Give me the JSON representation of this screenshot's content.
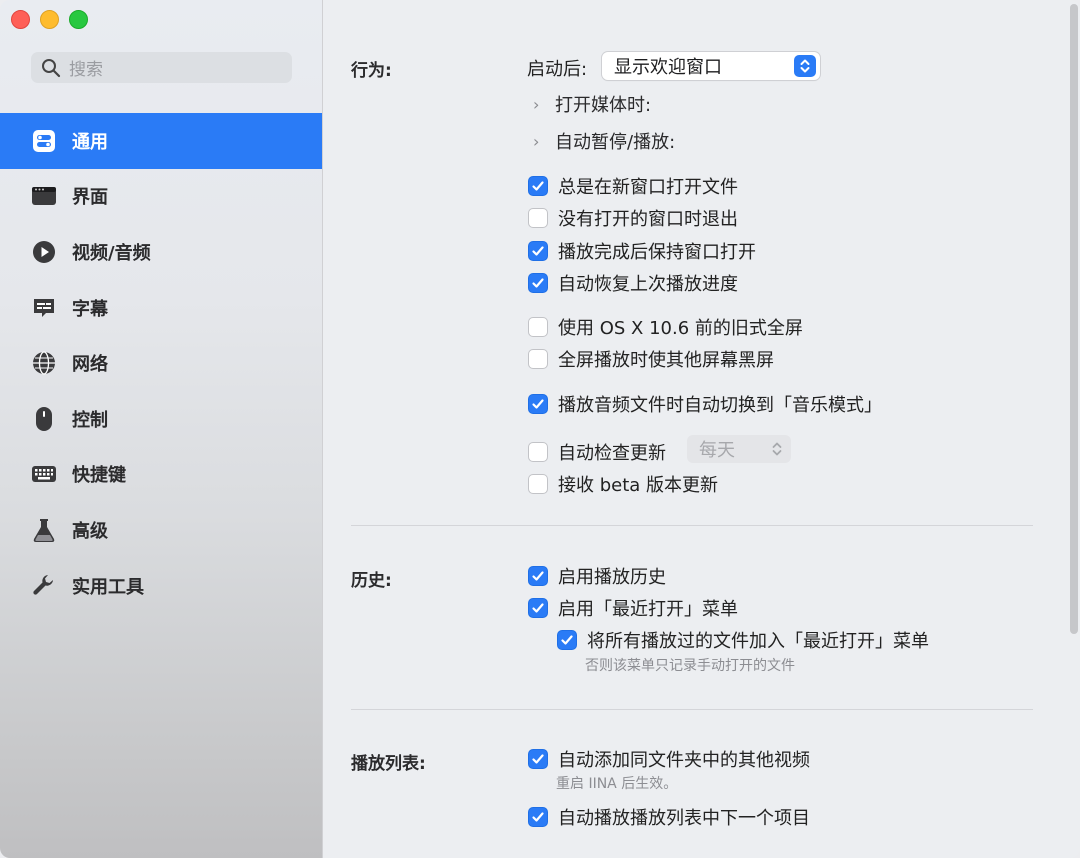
{
  "sidebar": {
    "search_placeholder": "搜索",
    "items": [
      {
        "label": "通用",
        "icon": "general-toggle-icon",
        "active": true
      },
      {
        "label": "界面",
        "icon": "window-icon",
        "active": false
      },
      {
        "label": "视频/音频",
        "icon": "play-circle-icon",
        "active": false
      },
      {
        "label": "字幕",
        "icon": "subtitle-bubble-icon",
        "active": false
      },
      {
        "label": "网络",
        "icon": "globe-icon",
        "active": false
      },
      {
        "label": "控制",
        "icon": "mouse-icon",
        "active": false
      },
      {
        "label": "快捷键",
        "icon": "keyboard-icon",
        "active": false
      },
      {
        "label": "高级",
        "icon": "flask-icon",
        "active": false
      },
      {
        "label": "实用工具",
        "icon": "wrench-icon",
        "active": false
      }
    ]
  },
  "behavior": {
    "label": "行为:",
    "after_launch_label": "启动后:",
    "after_launch_value": "显示欢迎窗口",
    "open_media_label": "打开媒体时:",
    "auto_pause_label": "自动暂停/播放:",
    "options": [
      {
        "label": "总是在新窗口打开文件",
        "checked": true
      },
      {
        "label": "没有打开的窗口时退出",
        "checked": false
      },
      {
        "label": "播放完成后保持窗口打开",
        "checked": true
      },
      {
        "label": "自动恢复上次播放进度",
        "checked": true
      },
      {
        "label": "使用 OS X 10.6 前的旧式全屏",
        "checked": false
      },
      {
        "label": "全屏播放时使其他屏幕黑屏",
        "checked": false
      },
      {
        "label": "播放音频文件时自动切换到「音乐模式」",
        "checked": true
      },
      {
        "label": "自动检查更新",
        "checked": false
      },
      {
        "label": "接收 beta 版本更新",
        "checked": false
      }
    ],
    "update_frequency": "每天"
  },
  "history": {
    "label": "历史:",
    "options": [
      {
        "label": "启用播放历史",
        "checked": true
      },
      {
        "label": "启用「最近打开」菜单",
        "checked": true
      },
      {
        "label": "将所有播放过的文件加入「最近打开」菜单",
        "checked": true
      }
    ],
    "hint": "否则该菜单只记录手动打开的文件"
  },
  "playlist": {
    "label": "播放列表:",
    "options": [
      {
        "label": "自动添加同文件夹中的其他视频",
        "checked": true
      },
      {
        "label": "自动播放播放列表中下一个项目",
        "checked": true
      }
    ],
    "hint": "重启 IINA 后生效。"
  },
  "colors": {
    "accent": "#2a7bf6",
    "close": "#fe5f57",
    "minimize": "#febc2e",
    "maximize": "#28c840"
  }
}
